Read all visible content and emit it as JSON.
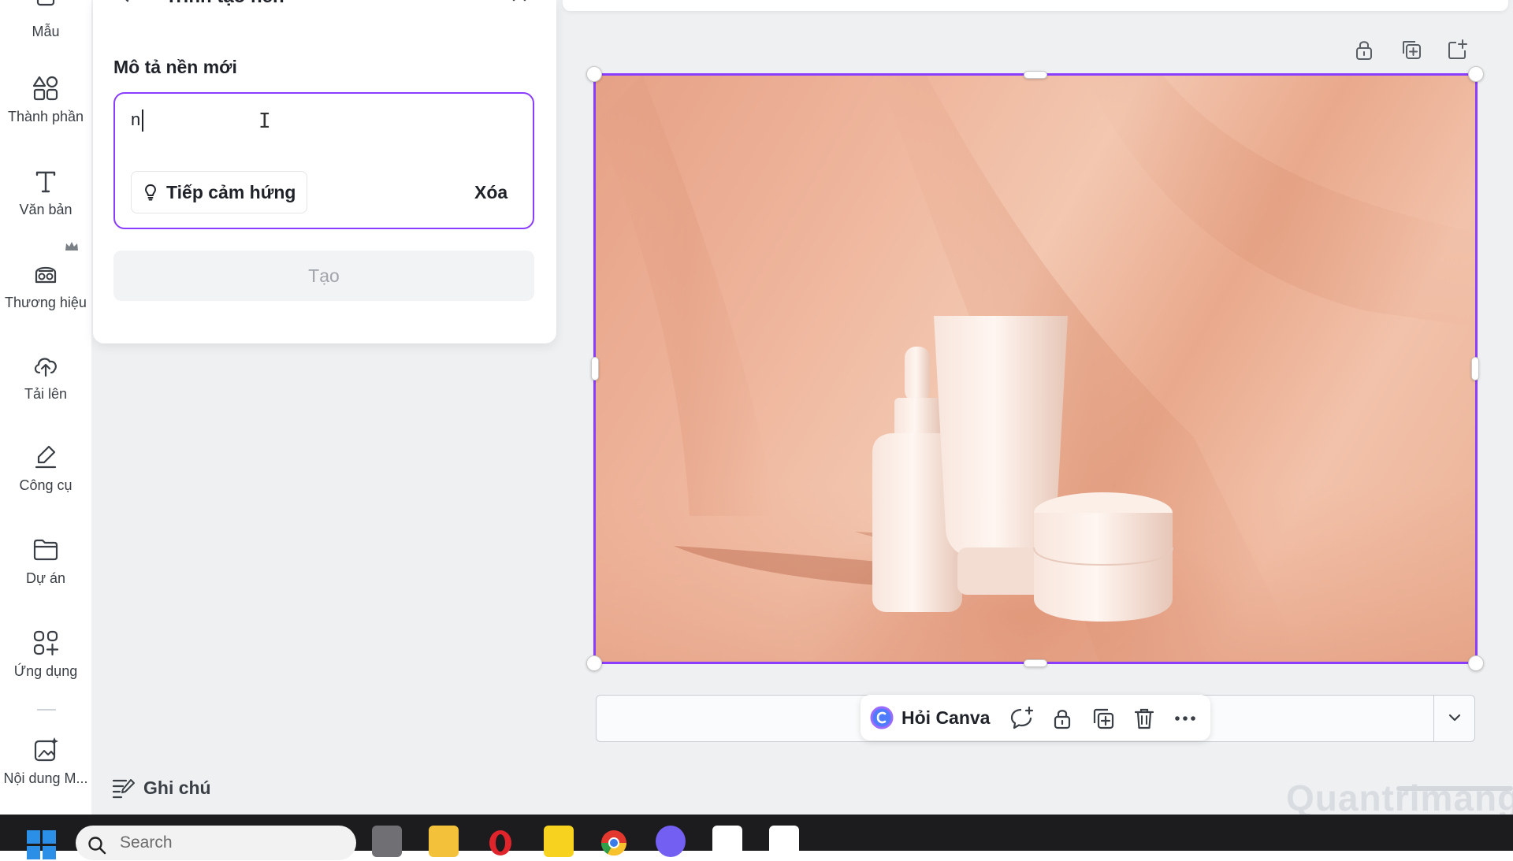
{
  "rail": {
    "items": [
      {
        "label": "Mẫu",
        "icon": "template-icon"
      },
      {
        "label": "Thành phần",
        "icon": "elements-icon"
      },
      {
        "label": "Văn bản",
        "icon": "text-icon"
      },
      {
        "label": "Thương hiệu",
        "icon": "brand-icon"
      },
      {
        "label": "Tải lên",
        "icon": "upload-icon"
      },
      {
        "label": "Công cụ",
        "icon": "tools-icon"
      },
      {
        "label": "Dự án",
        "icon": "folder-icon"
      },
      {
        "label": "Ứng dụng",
        "icon": "apps-icon"
      },
      {
        "label": "Nội dung M...",
        "icon": "magic-media-icon"
      }
    ]
  },
  "panel": {
    "title": "Trình tạo nền",
    "section_label": "Mô tả nền mới",
    "prompt_value": "n",
    "inspire_label": "Tiếp cảm hứng",
    "clear_label": "Xóa",
    "create_label": "Tạo"
  },
  "notes_label": "Ghi chú",
  "context_toolbar": {
    "ask_label": "Hỏi Canva"
  },
  "watermark": "Quantrimang",
  "taskbar": {
    "search_placeholder": "Search"
  },
  "colors": {
    "accent": "#8b3dff",
    "background_peach": "#efb79e"
  }
}
